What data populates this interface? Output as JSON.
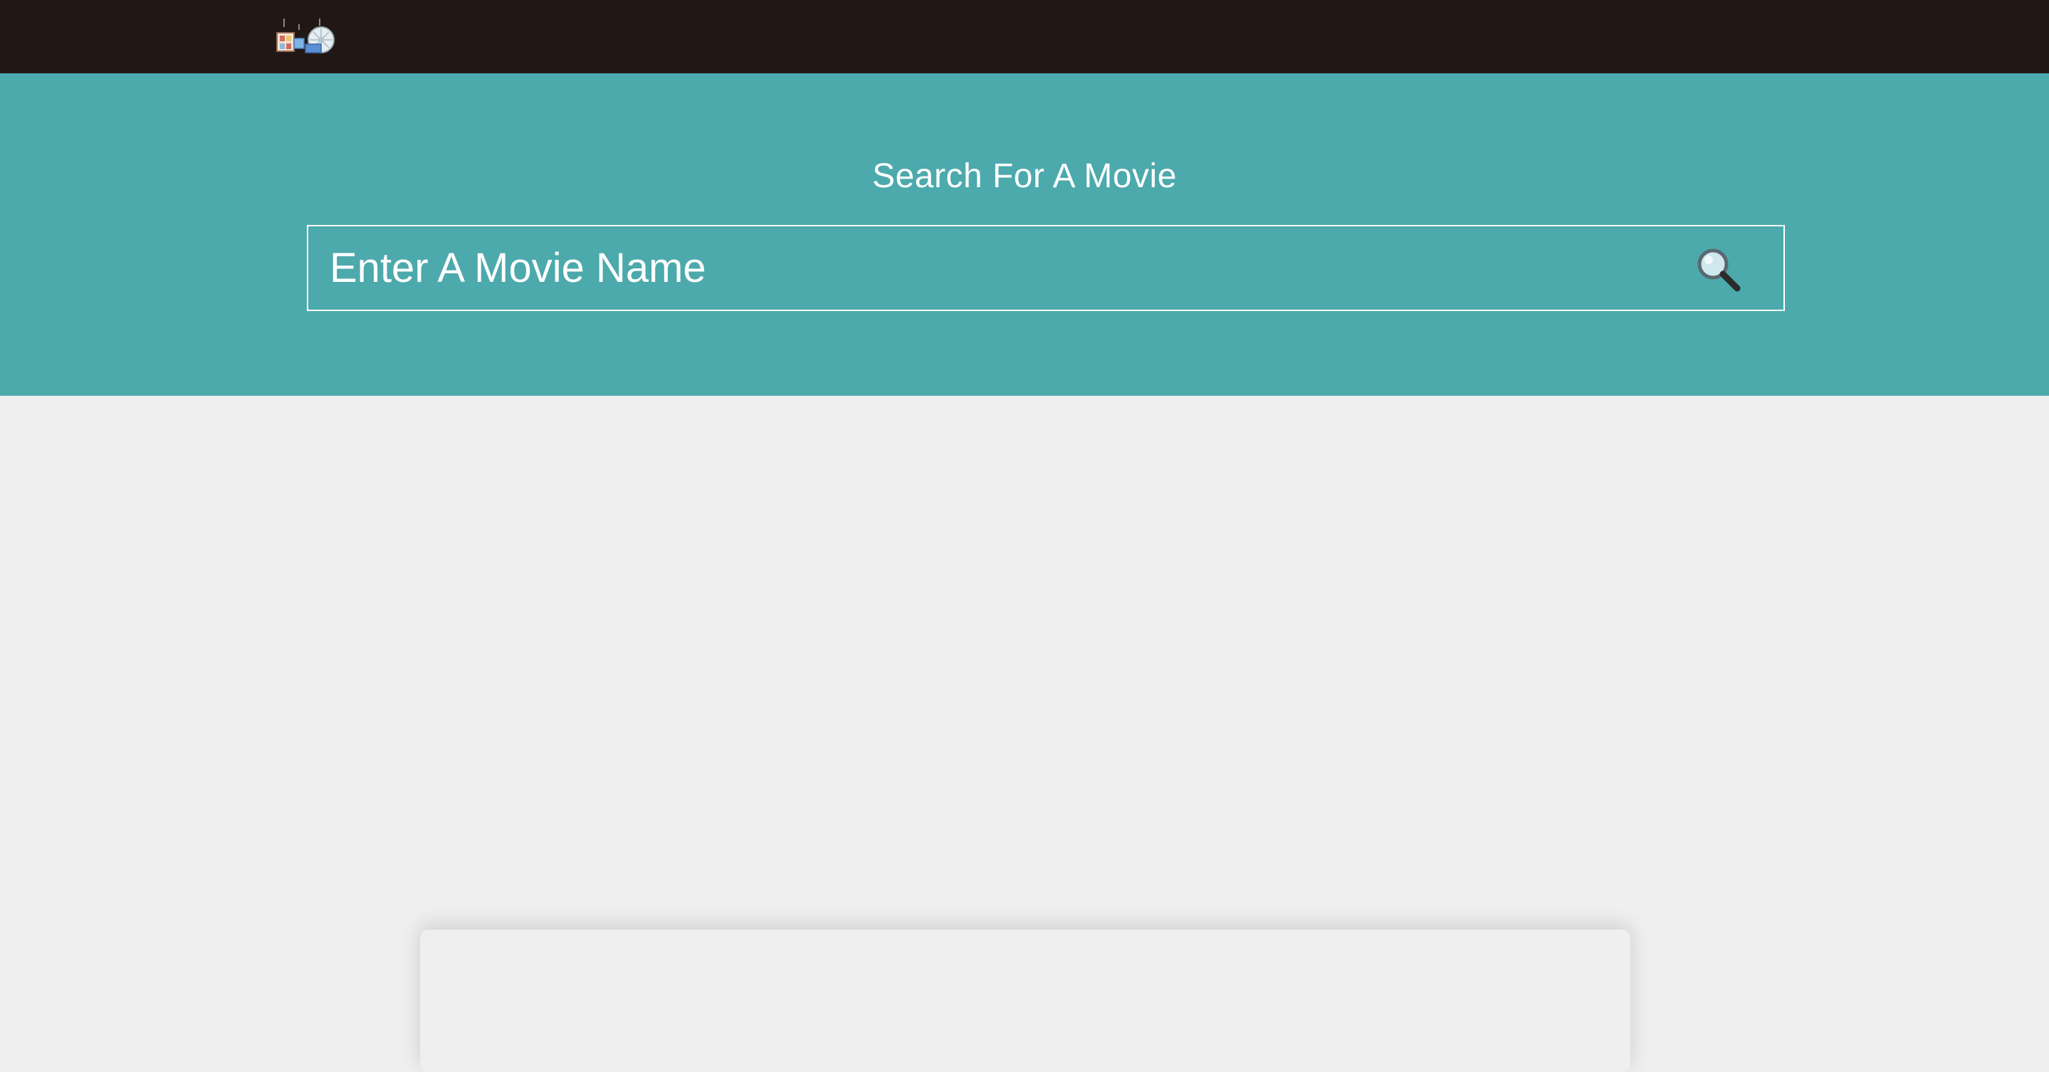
{
  "header": {
    "logo_icon": "movie-projector-logo-icon",
    "background_color": "#211816"
  },
  "hero": {
    "title": "Search For A Movie",
    "background_color": "#4ca9ac"
  },
  "search": {
    "placeholder": "Enter A Movie Name",
    "value": "",
    "button_icon": "magnifying-glass-icon"
  }
}
